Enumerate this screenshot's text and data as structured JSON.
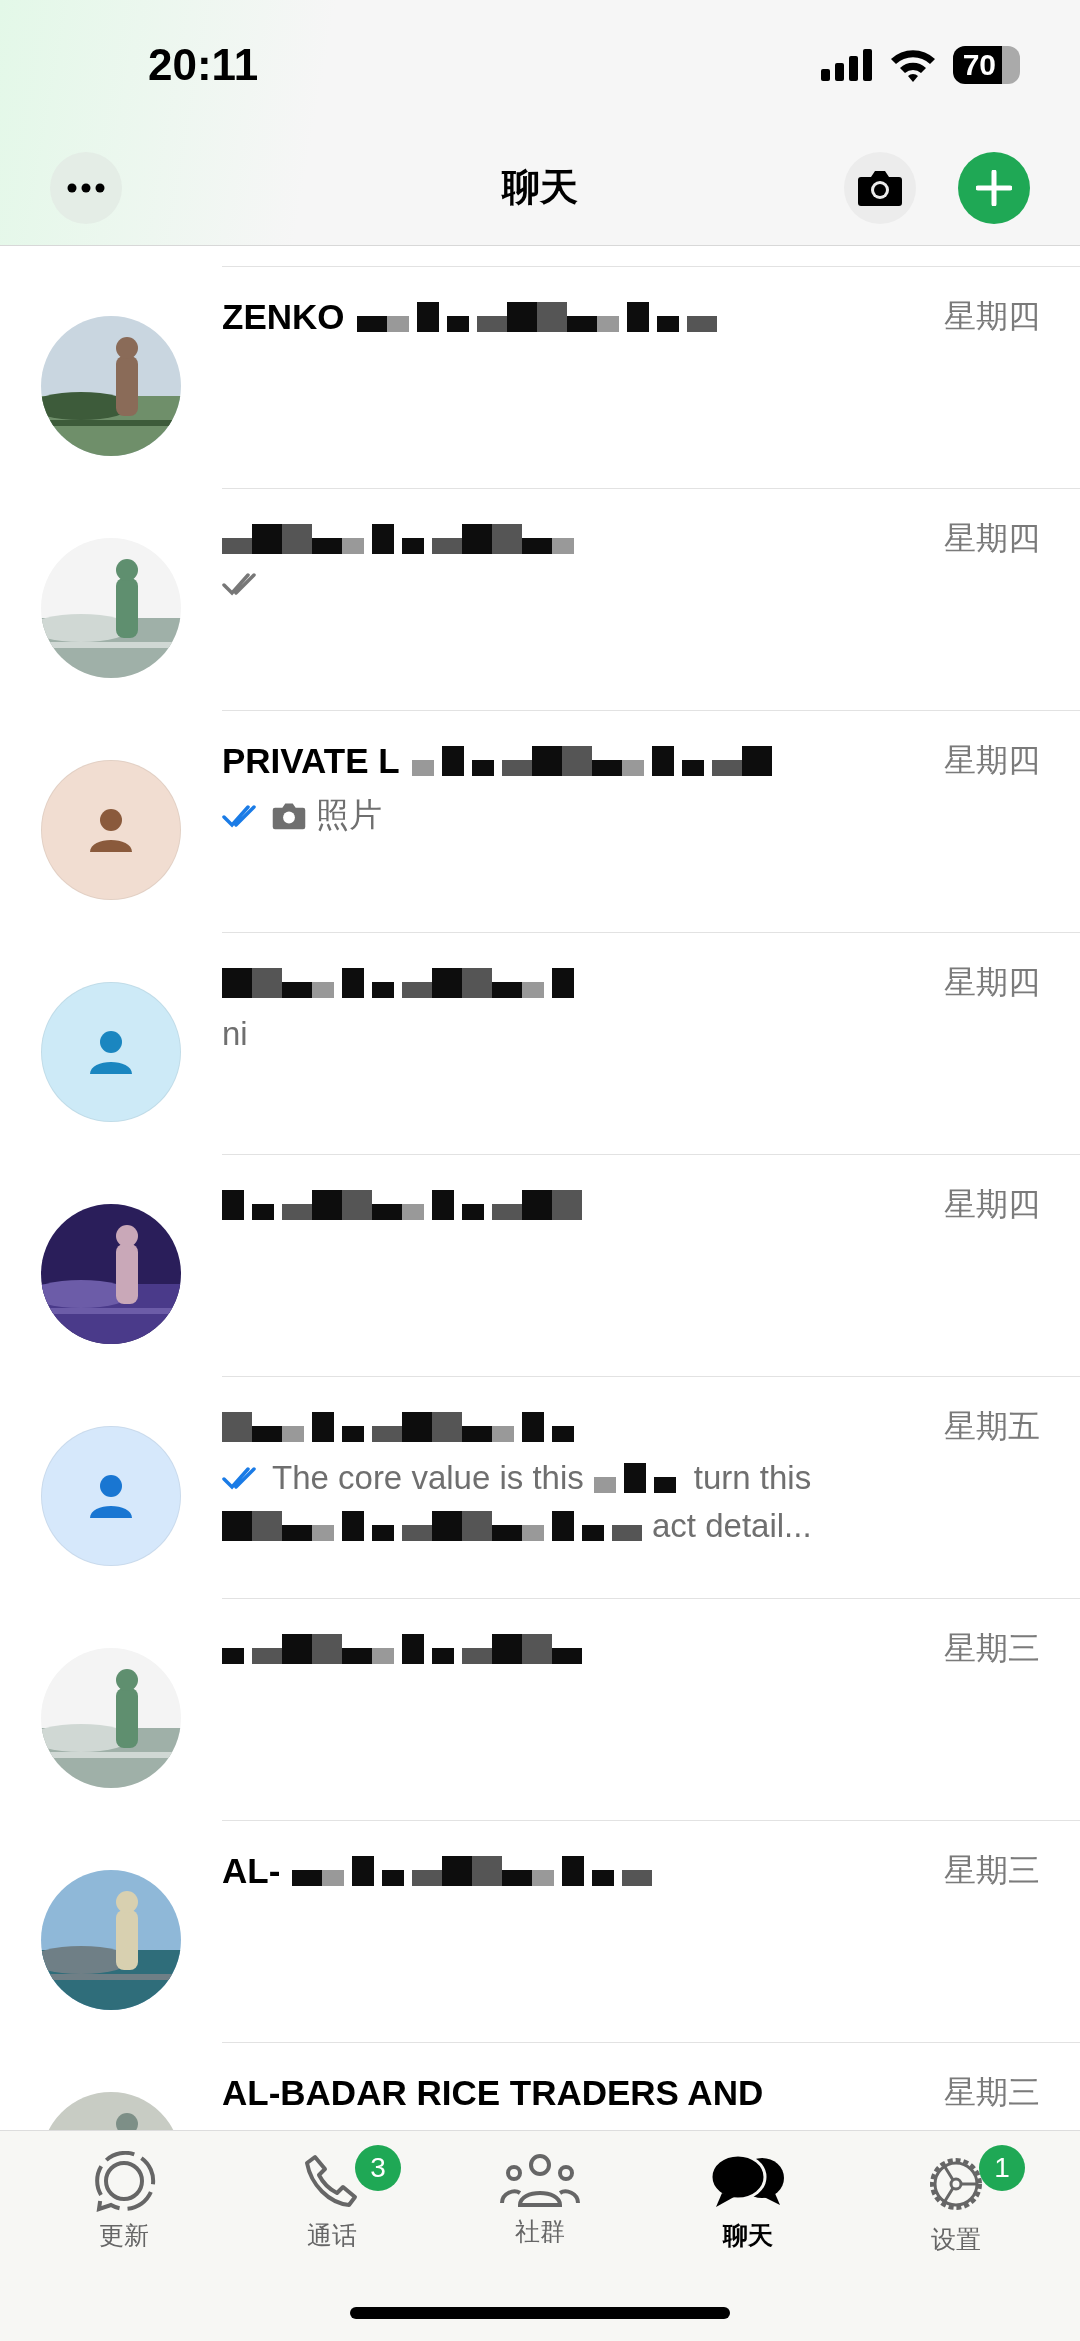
{
  "status_bar": {
    "time": "20:11",
    "battery": "70"
  },
  "header": {
    "title": "聊天"
  },
  "chats": [
    {
      "name": "ZENKO",
      "censored": true,
      "date": "星期四"
    },
    {
      "censored": true,
      "date": "星期四",
      "delivered": true,
      "read": false
    },
    {
      "avatar": {
        "kind": "placeholder",
        "color": "#8a5a3c"
      },
      "name": "PRIVATE L",
      "censored": true,
      "date": "星期四",
      "delivered": true,
      "read": true,
      "photo_attachment": true,
      "preview": "照片"
    },
    {
      "avatar": {
        "kind": "placeholder",
        "color": "#1a86c0"
      },
      "censored": true,
      "date": "星期四",
      "preview": "ni"
    },
    {
      "censored": true,
      "date": "星期四"
    },
    {
      "avatar": {
        "kind": "placeholder",
        "color": "#1976d2"
      },
      "censored": true,
      "date": "星期五",
      "delivered": true,
      "read": true,
      "preview_parts": [
        "The core value is this",
        "turn this",
        "act detail..."
      ]
    },
    {
      "censored": true,
      "date": "星期三"
    },
    {
      "name": "AL-",
      "censored": true,
      "date": "星期三"
    },
    {
      "name": "AL-BADAR RICE TRADERS AND",
      "censored": false,
      "date": "星期三"
    }
  ],
  "tabs": [
    {
      "label": "更新",
      "selected": false
    },
    {
      "label": "通话",
      "selected": false,
      "badge": "3"
    },
    {
      "label": "社群",
      "selected": false
    },
    {
      "label": "聊天",
      "selected": true
    },
    {
      "label": "设置",
      "selected": false,
      "badge": "1"
    }
  ]
}
